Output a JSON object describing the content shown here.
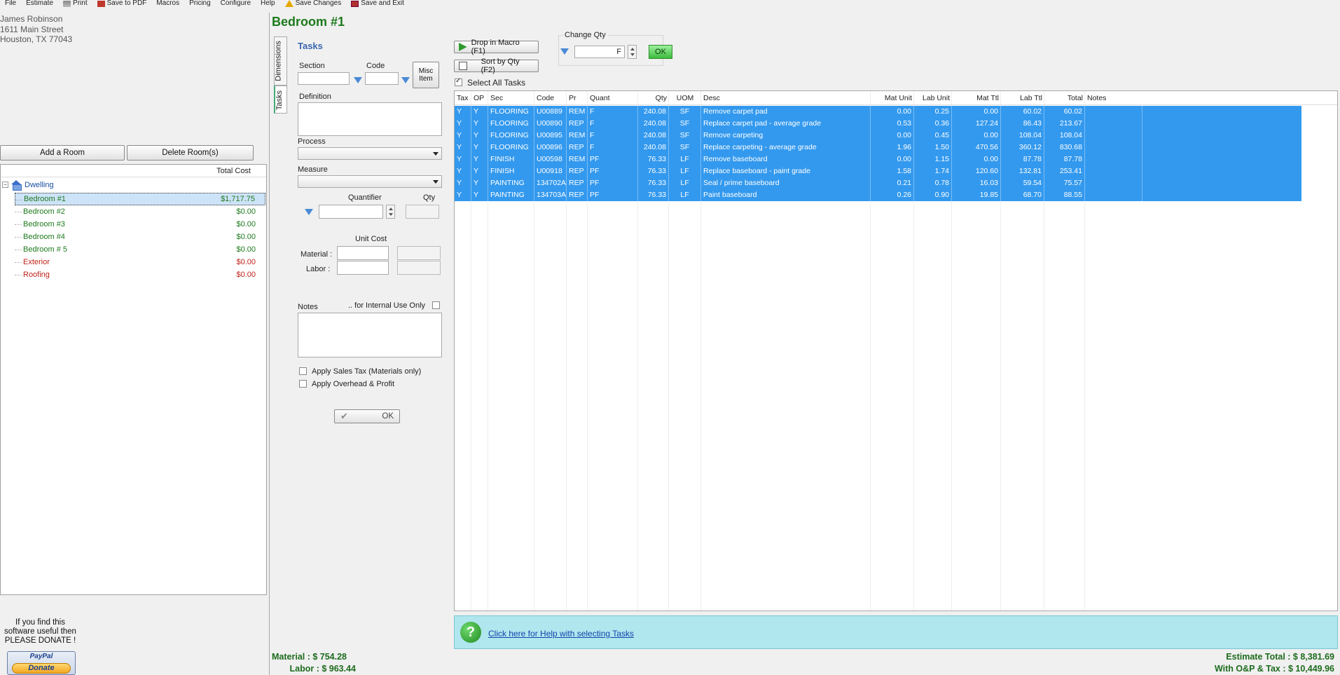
{
  "menu": [
    {
      "label": "File",
      "icon": ""
    },
    {
      "label": "Estimate",
      "icon": ""
    },
    {
      "label": "Print",
      "icon": "printer-icon"
    },
    {
      "label": "Save to PDF",
      "icon": "pdf-icon"
    },
    {
      "label": "Macros",
      "icon": ""
    },
    {
      "label": "Pricing",
      "icon": ""
    },
    {
      "label": "Configure",
      "icon": ""
    },
    {
      "label": "Help",
      "icon": ""
    },
    {
      "label": "Save Changes",
      "icon": "warning-icon"
    },
    {
      "label": "Save and Exit",
      "icon": "exit-icon"
    }
  ],
  "client": {
    "name": "James Robinson",
    "street": "1611 Main Street",
    "city": "Houston, TX 77043"
  },
  "room_buttons": {
    "add": "Add a Room",
    "delete": "Delete Room(s)"
  },
  "tree": {
    "header": "Total Cost",
    "root": "Dwelling",
    "rooms": [
      {
        "name": "Bedroom #1",
        "cost": "$1,717.75",
        "color": "#1d7a1d",
        "selected": true
      },
      {
        "name": "Bedroom #2",
        "cost": "$0.00",
        "color": "#1d7a1d"
      },
      {
        "name": "Bedroom #3",
        "cost": "$0.00",
        "color": "#1d7a1d"
      },
      {
        "name": "Bedroom #4",
        "cost": "$0.00",
        "color": "#1d7a1d"
      },
      {
        "name": "Bedroom # 5",
        "cost": "$0.00",
        "color": "#1d7a1d"
      },
      {
        "name": "Exterior",
        "cost": "$0.00",
        "color": "#c0221a"
      },
      {
        "name": "Roofing",
        "cost": "$0.00",
        "color": "#c0221a"
      }
    ]
  },
  "donate": {
    "line1": "If you find this",
    "line2": "software useful then",
    "line3": "PLEASE DONATE !",
    "paypal": "PayPal",
    "button": "Donate"
  },
  "room_title": "Bedroom #1",
  "vtabs": {
    "dimensions": "Dimensions",
    "tasks": "Tasks"
  },
  "form": {
    "heading": "Tasks",
    "section_label": "Section",
    "code_label": "Code",
    "misc_item": "Misc Item",
    "definition_label": "Definition",
    "process_label": "Process",
    "measure_label": "Measure",
    "quantifier_label": "Quantifier",
    "qty_label": "Qty",
    "unit_cost_label": "Unit Cost",
    "material_label": "Material :",
    "labor_label": "Labor :",
    "notes_label": "Notes",
    "internal_label": ".. for Internal Use Only",
    "apply_tax": "Apply Sales Tax (Materials only)",
    "apply_op": "Apply Overhead & Profit",
    "ok": "OK"
  },
  "toolbar": {
    "drop_macro": "Drop in Macro (F1)",
    "sort_qty": "Sort by Qty (F2)",
    "change_qty": "Change Qty",
    "change_qty_value": "F",
    "ok": "OK",
    "select_all": "Select All Tasks"
  },
  "grid": {
    "columns": [
      "Tax",
      "OP",
      "Sec",
      "Code",
      "Pr",
      "Quant",
      "Qty",
      "UOM",
      "Desc",
      "Mat Unit",
      "Lab Unit",
      "Mat Ttl",
      "Lab Ttl",
      "Total",
      "Notes"
    ],
    "rows": [
      [
        "Y",
        "Y",
        "FLOORING",
        "U00889",
        "REM",
        "F",
        "240.08",
        "SF",
        "Remove carpet pad",
        "0.00",
        "0.25",
        "0.00",
        "60.02",
        "60.02",
        ""
      ],
      [
        "Y",
        "Y",
        "FLOORING",
        "U00890",
        "REP",
        "F",
        "240.08",
        "SF",
        "Replace carpet pad - average grade",
        "0.53",
        "0.36",
        "127.24",
        "86.43",
        "213.67",
        ""
      ],
      [
        "Y",
        "Y",
        "FLOORING",
        "U00895",
        "REM",
        "F",
        "240.08",
        "SF",
        "Remove carpeting",
        "0.00",
        "0.45",
        "0.00",
        "108.04",
        "108.04",
        ""
      ],
      [
        "Y",
        "Y",
        "FLOORING",
        "U00896",
        "REP",
        "F",
        "240.08",
        "SF",
        "Replace carpeting - average grade",
        "1.96",
        "1.50",
        "470.56",
        "360.12",
        "830.68",
        ""
      ],
      [
        "Y",
        "Y",
        "FINISH",
        "U00598",
        "REM",
        "PF",
        "76.33",
        "LF",
        "Remove baseboard",
        "0.00",
        "1.15",
        "0.00",
        "87.78",
        "87.78",
        ""
      ],
      [
        "Y",
        "Y",
        "FINISH",
        "U00918",
        "REP",
        "PF",
        "76.33",
        "LF",
        "Replace baseboard - paint grade",
        "1.58",
        "1.74",
        "120.60",
        "132.81",
        "253.41",
        ""
      ],
      [
        "Y",
        "Y",
        "PAINTING",
        "134702A",
        "REP",
        "PF",
        "76.33",
        "LF",
        "Seal / prime  baseboard",
        "0.21",
        "0.78",
        "16.03",
        "59.54",
        "75.57",
        ""
      ],
      [
        "Y",
        "Y",
        "PAINTING",
        "134703A",
        "REP",
        "PF",
        "76.33",
        "LF",
        "Paint baseboard",
        "0.26",
        "0.90",
        "19.85",
        "68.70",
        "88.55",
        ""
      ]
    ],
    "selected_color": "#3399ee"
  },
  "help": {
    "link": "Click here for Help with selecting Tasks"
  },
  "totals": {
    "material": "Material : $ 754.28",
    "labor": "Labor : $ 963.44",
    "estimate": "Estimate Total : $ 8,381.69",
    "with_op": "With O&P & Tax : $ 10,449.96"
  }
}
